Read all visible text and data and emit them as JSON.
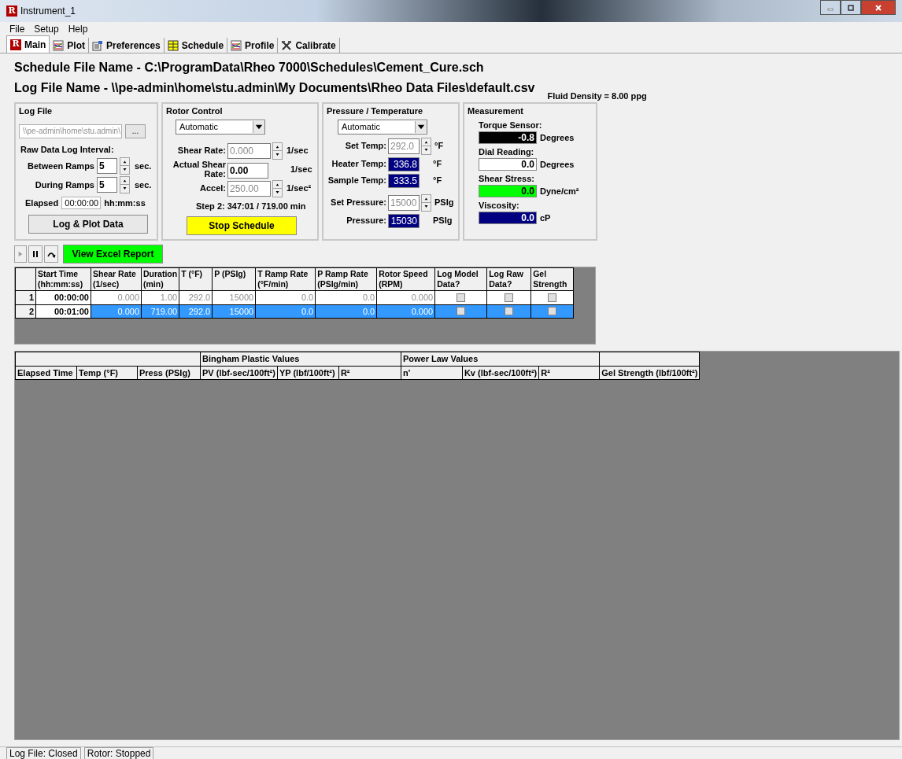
{
  "window": {
    "logo_text": "R",
    "title": "Instrument_1"
  },
  "menu": [
    "File",
    "Setup",
    "Help"
  ],
  "tabs": [
    {
      "label": "Main",
      "icon_text": "R",
      "selected": true
    },
    {
      "label": "Plot",
      "selected": false
    },
    {
      "label": "Preferences",
      "selected": false
    },
    {
      "label": "Schedule",
      "selected": false
    },
    {
      "label": "Profile",
      "selected": false
    },
    {
      "label": "Calibrate",
      "selected": false
    }
  ],
  "schedule_file": "Schedule File Name - C:\\ProgramData\\Rheo 7000\\Schedules\\Cement_Cure.sch",
  "log_file_name": "Log File Name - \\\\pe-admin\\home\\stu.admin\\My Documents\\Rheo Data Files\\default.csv",
  "fluid_density": "Fluid Density = 8.00 ppg",
  "log_file": {
    "title": "Log File",
    "path": "\\\\pe-admin\\home\\stu.admin\\",
    "browse": "...",
    "interval_label": "Raw Data Log Interval:",
    "between": {
      "label": "Between Ramps",
      "value": "5",
      "unit": "sec."
    },
    "during": {
      "label": "During Ramps",
      "value": "5",
      "unit": "sec."
    },
    "elapsed": {
      "label": "Elapsed",
      "value": "00:00:00",
      "unit": "hh:mm:ss"
    },
    "button": "Log & Plot Data"
  },
  "rotor": {
    "title": "Rotor Control",
    "mode": "Automatic",
    "shear_rate": {
      "label": "Shear Rate:",
      "value": "0.000",
      "unit": "1/sec",
      "disabled": true
    },
    "actual": {
      "label": "Actual Shear Rate:",
      "value": "0.00",
      "unit": "1/sec"
    },
    "accel": {
      "label": "Accel:",
      "value": "250.00",
      "unit": "1/sec²",
      "disabled": true
    },
    "step": "Step 2: 347:01 / 719.00 min",
    "button": "Stop Schedule"
  },
  "pressure_temperature": {
    "title": "Pressure / Temperature",
    "mode": "Automatic",
    "rows": [
      {
        "kind": "spin",
        "label": "Set Temp:",
        "value": "292.0",
        "unit": "°F"
      },
      {
        "kind": "readout",
        "label": "Heater Temp:",
        "value": "336.8",
        "unit": "°F"
      },
      {
        "kind": "readout",
        "label": "Sample Temp:",
        "value": "333.5",
        "unit": "°F"
      },
      {
        "kind": "spin",
        "label": "Set Pressure:",
        "value": "15000",
        "unit": "PSIg"
      },
      {
        "kind": "readout",
        "label": "Pressure:",
        "value": "15030",
        "unit": "PSIg"
      }
    ]
  },
  "measurement": {
    "title": "Measurement",
    "items": [
      {
        "label": "Torque Sensor:",
        "value": "-0.8",
        "unit": "Degrees",
        "color": "#000000"
      },
      {
        "label": "Dial Reading:",
        "value": "0.0",
        "unit": "Degrees",
        "color": "#ffffff"
      },
      {
        "label": "Shear Stress:",
        "value": "0.0",
        "unit": "Dyne/cm²",
        "color": "#00ff00"
      },
      {
        "label": "Viscosity:",
        "value": "0.0",
        "unit": "cP",
        "color": "#000080"
      }
    ]
  },
  "toolbar": {
    "play_disabled": true,
    "report_button": "View Excel Report"
  },
  "schedule_table": {
    "columns": [
      "Start Time (hh:mm:ss)",
      "Shear Rate (1/sec)",
      "Duration (min)",
      "T (°F)",
      "P (PSIg)",
      "T Ramp Rate (°F/min)",
      "P Ramp Rate (PSIg/min)",
      "Rotor Speed (RPM)",
      "Log Model Data?",
      "Log Raw Data?",
      "Gel Strength"
    ],
    "rows": [
      {
        "number": "1",
        "selected": false,
        "cells": [
          "00:00:00",
          "0.000",
          "1.00",
          "292.0",
          "15000",
          "0.0",
          "0.0",
          "0.000"
        ],
        "checks": [
          false,
          false,
          false
        ]
      },
      {
        "number": "2",
        "selected": true,
        "cells": [
          "00:01:00",
          "0.000",
          "719.00",
          "292.0",
          "15000",
          "0.0",
          "0.0",
          "0.000"
        ],
        "checks": [
          false,
          false,
          false
        ]
      }
    ]
  },
  "results_table": {
    "bingham_header": "Bingham Plastic Values",
    "power_law_header": "Power Law Values",
    "columns": [
      "Elapsed Time",
      "Temp (°F)",
      "Press (PSIg)",
      "PV (lbf-sec/100ft²)",
      "YP (lbf/100ft²)",
      "R²",
      "n'",
      "Kv (lbf-sec/100ft²)",
      "R²",
      "Gel Strength (lbf/100ft²)"
    ]
  },
  "status_bar": [
    "Log File: Closed",
    "Rotor: Stopped"
  ]
}
